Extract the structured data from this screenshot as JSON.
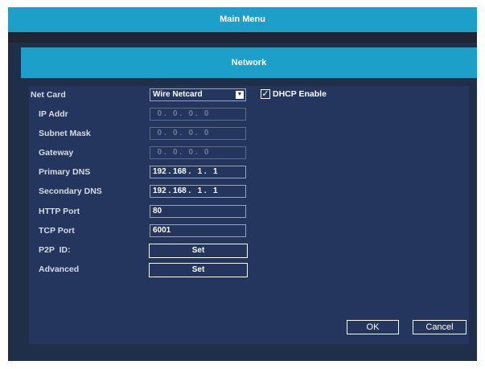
{
  "window": {
    "title": "Main Menu"
  },
  "dialog": {
    "title": "Network"
  },
  "form": {
    "net_card": {
      "label": "Net Card",
      "value": "Wire Netcard",
      "dropdown_icon": "chevron-down-icon"
    },
    "dhcp": {
      "label": "DHCP Enable",
      "checked": true,
      "check_glyph": "✓"
    },
    "ip_addr": {
      "label": "IP Addr",
      "value": "  0 .   0 .   0 .   0"
    },
    "subnet_mask": {
      "label": "Subnet Mask",
      "value": "  0 .   0 .   0 .   0"
    },
    "gateway": {
      "label": "Gateway",
      "value": "  0 .   0 .   0 .   0"
    },
    "primary_dns": {
      "label": "Primary DNS",
      "value": "192 . 168 .   1 .   1"
    },
    "secondary_dns": {
      "label": "Secondary DNS",
      "value": "192 . 168 .   1 .   1"
    },
    "http_port": {
      "label": "HTTP Port",
      "value": "80"
    },
    "tcp_port": {
      "label": "TCP Port",
      "value": "6001"
    },
    "p2p_id": {
      "label": "P2P  ID:",
      "button": "Set"
    },
    "advanced": {
      "label": "Advanced",
      "button": "Set"
    }
  },
  "buttons": {
    "ok": "OK",
    "cancel": "Cancel"
  },
  "colors": {
    "header": "#1c9fc8",
    "panel": "#24365e",
    "background": "#1f2f49"
  }
}
